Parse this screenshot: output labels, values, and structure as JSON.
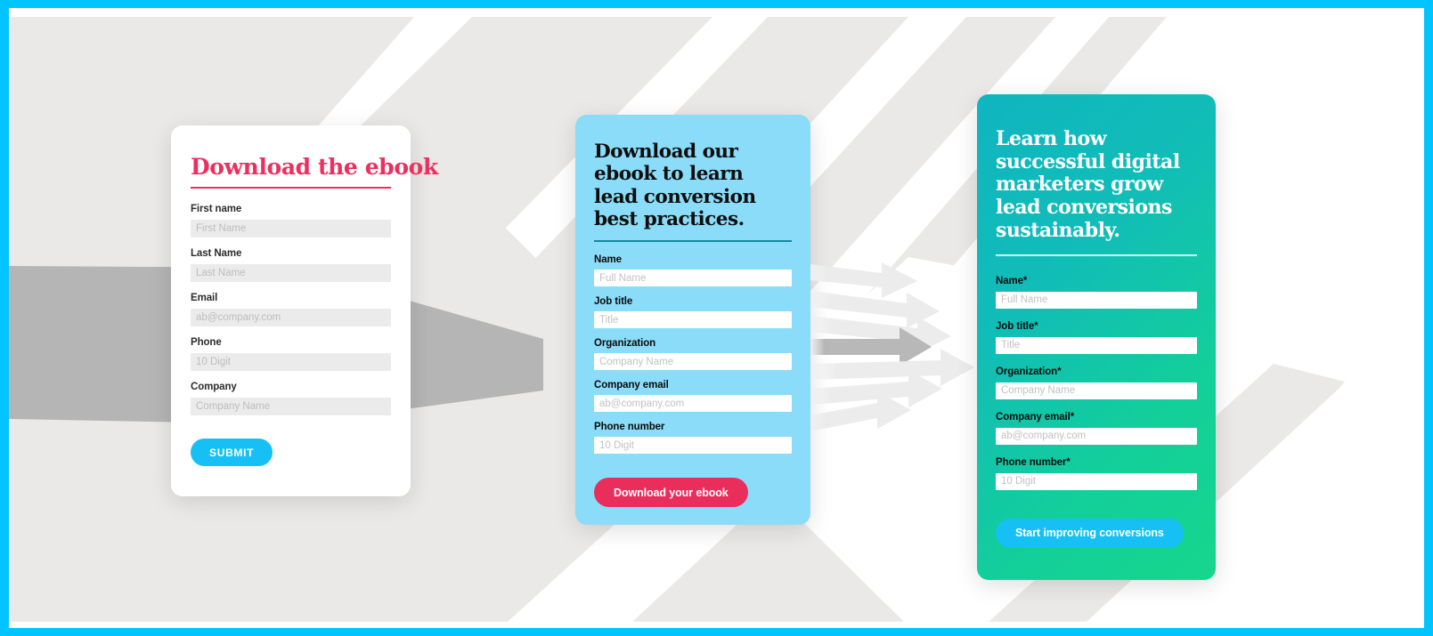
{
  "page": {
    "border_color": "#00c4ff",
    "background_color": "#ffffff",
    "ribbon_color": "#ebe9e8",
    "ribbon_accent_color": "#b5b5b5",
    "arrow_color": "#ececec",
    "arrow_accent_color": "#b8b8b8"
  },
  "cards": {
    "basic": {
      "title": "Download the ebook",
      "accent_color": "#ec2f5e",
      "background_color": "#ffffff",
      "input_background": "#ebebeb",
      "fields": [
        {
          "label": "First name",
          "placeholder": "First Name",
          "value": ""
        },
        {
          "label": "Last Name",
          "placeholder": "Last Name",
          "value": ""
        },
        {
          "label": "Email",
          "placeholder": "ab@company.com",
          "value": ""
        },
        {
          "label": "Phone",
          "placeholder": "10 Digit",
          "value": ""
        },
        {
          "label": "Company",
          "placeholder": "Company Name",
          "value": ""
        }
      ],
      "submit_label": "SUBMIT",
      "submit_color": "#16c0f5"
    },
    "blue": {
      "title": "Download our ebook to learn lead conversion best practices.",
      "accent_color": "#118a9e",
      "background_color": "#8adcf8",
      "input_background": "#ffffff",
      "fields": [
        {
          "label": "Name",
          "placeholder": "Full Name",
          "value": ""
        },
        {
          "label": "Job title",
          "placeholder": "Title",
          "value": ""
        },
        {
          "label": "Organization",
          "placeholder": "Company Name",
          "value": ""
        },
        {
          "label": "Company email",
          "placeholder": "ab@company.com",
          "value": ""
        },
        {
          "label": "Phone number",
          "placeholder": "10 Digit",
          "value": ""
        }
      ],
      "submit_label": "Download your ebook",
      "submit_color": "#ea2e5c"
    },
    "gradient": {
      "title": "Learn how successful digital marketers grow lead conversions sustainably.",
      "accent_color": "#ffffff",
      "background_gradient_from": "#10b5c0",
      "background_gradient_to": "#16d68c",
      "input_background": "#ffffff",
      "fields": [
        {
          "label": "Name*",
          "placeholder": "Full Name",
          "value": ""
        },
        {
          "label": "Job title*",
          "placeholder": "Title",
          "value": ""
        },
        {
          "label": "Organization*",
          "placeholder": "Company Name",
          "value": ""
        },
        {
          "label": "Company email*",
          "placeholder": "ab@company.com",
          "value": ""
        },
        {
          "label": "Phone number*",
          "placeholder": "10 Digit",
          "value": ""
        }
      ],
      "submit_label": "Start improving conversions",
      "submit_color": "#16c0f5"
    }
  }
}
